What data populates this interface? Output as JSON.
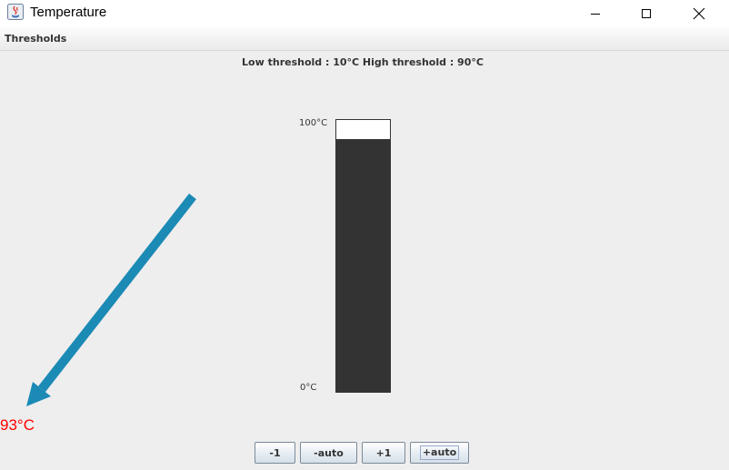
{
  "window": {
    "title": "Temperature",
    "minimize_icon": "minimize-icon",
    "maximize_icon": "maximize-icon",
    "close_icon": "close-icon"
  },
  "menu": {
    "items": [
      {
        "label": "Thresholds"
      }
    ]
  },
  "thresholds": {
    "label": "Low threshold : 10°C  High threshold : 90°C"
  },
  "thermometer": {
    "max_label": "100°C",
    "min_label": "0°C",
    "level": 0.93
  },
  "temperature": {
    "value_label": "93°C",
    "color": "#ff0000"
  },
  "annotation": {
    "arrow_color": "#1b8ab5"
  },
  "controls": {
    "decrement_label": "-1",
    "auto_decrement_label": "-auto",
    "increment_label": "+1",
    "auto_increment_label": "+auto"
  }
}
